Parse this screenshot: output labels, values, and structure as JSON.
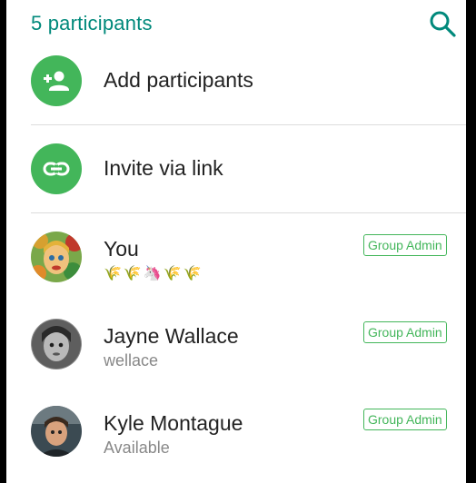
{
  "header": {
    "title": "5 participants",
    "search_icon": "search-icon"
  },
  "actions": [
    {
      "label": "Add participants",
      "icon": "add-person-icon"
    },
    {
      "label": "Invite via link",
      "icon": "link-icon"
    }
  ],
  "members": [
    {
      "name": "You",
      "status": "",
      "status_emoji": [
        "🌾",
        "🌾",
        "🦄",
        "🌾",
        "🌾"
      ],
      "badge": "Group Admin"
    },
    {
      "name": "Jayne Wallace",
      "status": "wellace",
      "badge": "Group Admin"
    },
    {
      "name": "Kyle Montague",
      "status": "Available",
      "badge": "Group Admin"
    }
  ],
  "colors": {
    "accent": "#00897b",
    "green": "#43b65a"
  }
}
